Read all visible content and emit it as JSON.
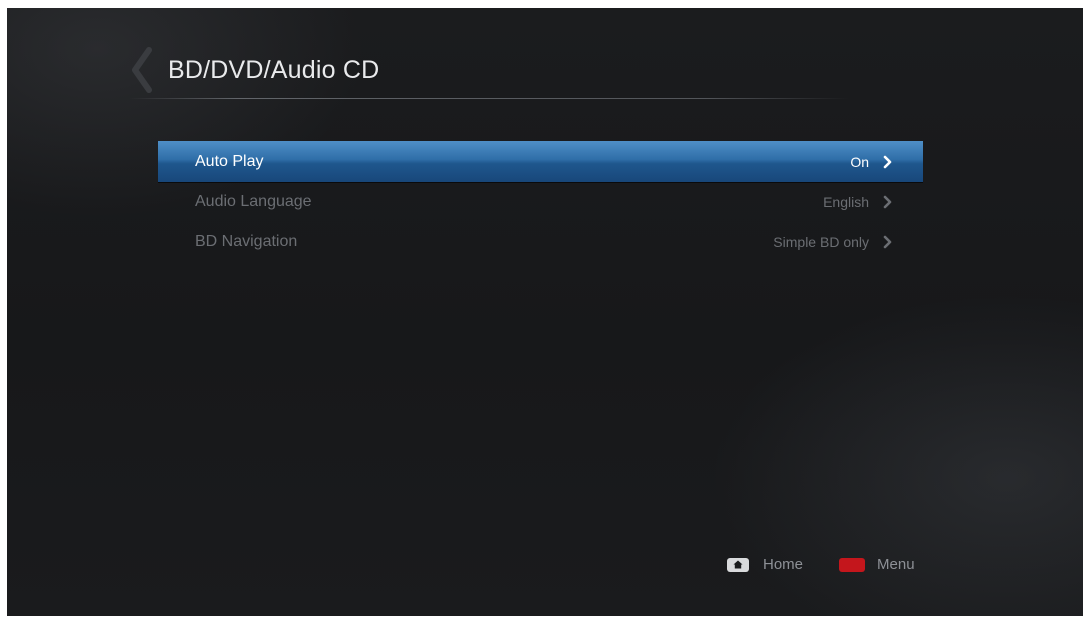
{
  "header": {
    "title": "BD/DVD/Audio CD"
  },
  "menu": {
    "items": [
      {
        "label": "Auto Play",
        "value": "On",
        "selected": true
      },
      {
        "label": "Audio Language",
        "value": "English",
        "selected": false
      },
      {
        "label": "BD Navigation",
        "value": "Simple BD only",
        "selected": false
      }
    ]
  },
  "footer": {
    "home_label": "Home",
    "menu_label": "Menu"
  },
  "colors": {
    "highlight": "#2f6ea8",
    "menu_key": "#c4161c",
    "background": "#1b1c1e"
  }
}
